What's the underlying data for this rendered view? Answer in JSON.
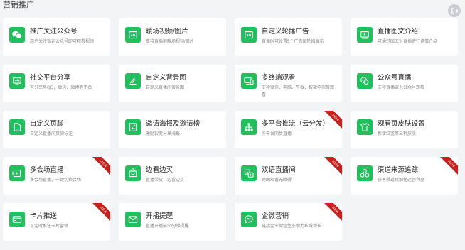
{
  "page": {
    "title": "营销推广"
  },
  "colors": {
    "accent": "#20c05c",
    "new_badge": "#c7201d",
    "background": "#f3f4f6"
  },
  "cards": [
    {
      "title": "推广关注公众号",
      "desc": "用户关注指定公众号即可观看视频",
      "icon": "wechat-icon",
      "is_new": false
    },
    {
      "title": "暖场视频/图片",
      "desc": "支持直播前暖场视频/图片",
      "icon": "ad-icon",
      "is_new": false
    },
    {
      "title": "自定义轮播广告",
      "desc": "直播时可设置5个广告图轮播展示",
      "icon": "ad-icon",
      "is_new": false
    },
    {
      "title": "直播图文介绍",
      "desc": "可通过图文对直播进行详情介绍",
      "icon": "video-intro-icon",
      "is_new": false
    },
    {
      "title": "社交平台分享",
      "desc": "可分享至QQ、微信、微博等平台",
      "icon": "share-icon",
      "is_new": false
    },
    {
      "title": "自定义背景图",
      "desc": "自定义直播间背景图",
      "icon": "brush-icon",
      "is_new": false
    },
    {
      "title": "多终端观看",
      "desc": "支持微信、电脑、平板、智能电视等观看",
      "icon": "multi-device-icon",
      "is_new": false
    },
    {
      "title": "公众号直播",
      "desc": "支持直播嵌入公众号观看",
      "icon": "chat-bubbles-icon",
      "is_new": false
    },
    {
      "title": "自定义页脚",
      "desc": "自定义直播间页脚标注",
      "icon": "document-icon",
      "is_new": false
    },
    {
      "title": "邀请海报及邀请榜",
      "desc": "激励裂变分享海报",
      "icon": "poster-icon",
      "is_new": false
    },
    {
      "title": "多平台推流（云分发）",
      "desc": "多平台同步直播",
      "icon": "hierarchy-icon",
      "is_new": true
    },
    {
      "title": "观看页皮肤设置",
      "desc": "新增红蓝等三种皮肤",
      "icon": "tshirt-icon",
      "is_new": false
    },
    {
      "title": "多会场直播",
      "desc": "多会场直播，一键切换会场",
      "icon": "multi-venue-icon",
      "is_new": true
    },
    {
      "title": "边看边买",
      "desc": "直播带货，边看边买",
      "icon": "shopping-bag-icon",
      "is_new": false
    },
    {
      "title": "双语直播间",
      "desc": "跨国观看无障碍",
      "icon": "bilingual-icon",
      "is_new": true
    },
    {
      "title": "渠道来源追踪",
      "desc": "获客渠道精细化运营利器",
      "icon": "channel-icon",
      "is_new": true
    },
    {
      "title": "卡片推送",
      "desc": "可定时推送卡片营销",
      "icon": "card-icon",
      "is_new": true
    },
    {
      "title": "开播提醒",
      "desc": "直播开播前30分钟提醒",
      "icon": "mail-icon",
      "is_new": false
    },
    {
      "title": "企微营销",
      "desc": "链接企业微信生态助力私域增长",
      "icon": "wecom-icon",
      "is_new": true
    }
  ],
  "new_badge_label": "NEW"
}
